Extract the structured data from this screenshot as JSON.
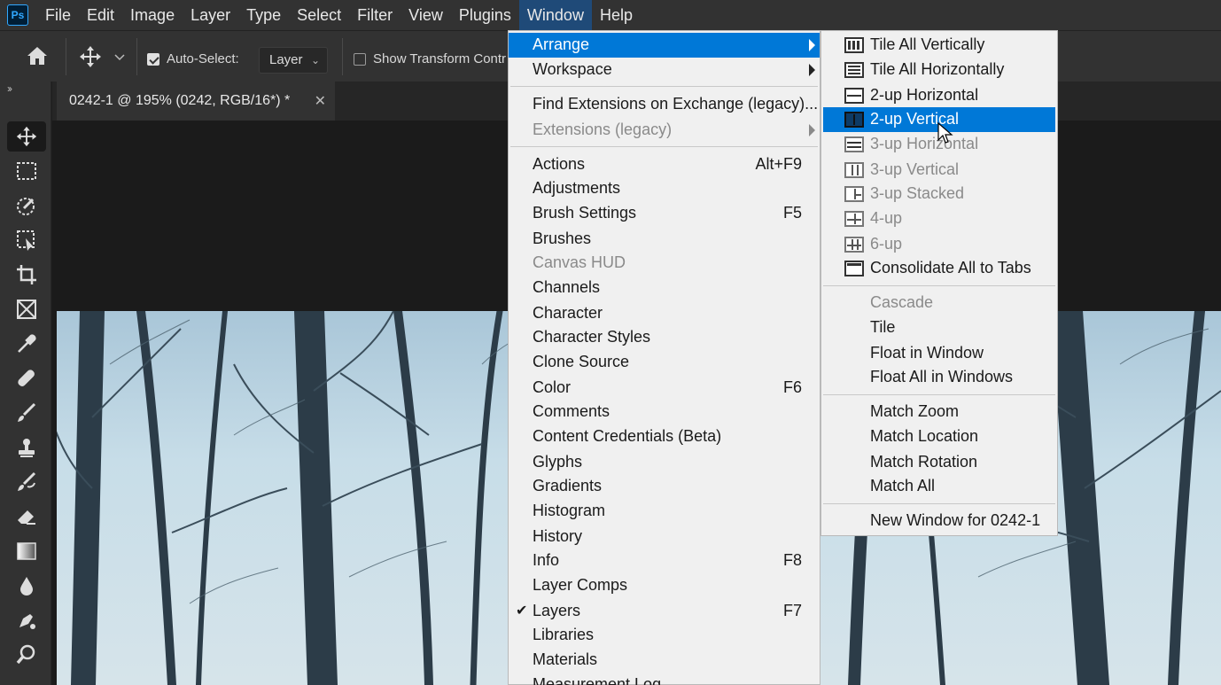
{
  "app": {
    "logo_text": "Ps"
  },
  "menubar": {
    "items": [
      "File",
      "Edit",
      "Image",
      "Layer",
      "Type",
      "Select",
      "Filter",
      "View",
      "Plugins",
      "Window",
      "Help"
    ],
    "active": "Window"
  },
  "options": {
    "auto_select_label": "Auto-Select:",
    "auto_select_checked": true,
    "auto_select_target": "Layer",
    "show_transform_label": "Show Transform Contr"
  },
  "tools": [
    "move-tool",
    "marquee-tool",
    "object-selection-tool",
    "frame-select-tool",
    "crop-tool",
    "frame-tool",
    "eyedropper-tool",
    "healing-brush-tool",
    "brush-tool",
    "clone-stamp-tool",
    "history-brush-tool",
    "eraser-tool",
    "gradient-tool",
    "blur-tool",
    "pen-tool",
    "zoom-tool"
  ],
  "document": {
    "tab_title": "0242-1 @ 195% (0242, RGB/16*) *"
  },
  "window_menu": {
    "items": [
      {
        "label": "Arrange",
        "submenu": true,
        "highlighted": true
      },
      {
        "label": "Workspace",
        "submenu": true
      },
      {
        "label": "Find Extensions on Exchange (legacy)..."
      },
      {
        "label": "Extensions (legacy)",
        "submenu": true,
        "disabled": true
      },
      {
        "label": "Actions",
        "shortcut": "Alt+F9"
      },
      {
        "label": "Adjustments"
      },
      {
        "label": "Brush Settings",
        "shortcut": "F5"
      },
      {
        "label": "Brushes"
      },
      {
        "label": "Canvas HUD",
        "disabled": true
      },
      {
        "label": "Channels"
      },
      {
        "label": "Character"
      },
      {
        "label": "Character Styles"
      },
      {
        "label": "Clone Source"
      },
      {
        "label": "Color",
        "shortcut": "F6"
      },
      {
        "label": "Comments"
      },
      {
        "label": "Content Credentials (Beta)"
      },
      {
        "label": "Glyphs"
      },
      {
        "label": "Gradients"
      },
      {
        "label": "Histogram"
      },
      {
        "label": "History"
      },
      {
        "label": "Info",
        "shortcut": "F8"
      },
      {
        "label": "Layer Comps"
      },
      {
        "label": "Layers",
        "shortcut": "F7",
        "checked": true
      },
      {
        "label": "Libraries"
      },
      {
        "label": "Materials"
      },
      {
        "label": "Measurement Log"
      }
    ]
  },
  "arrange_menu": {
    "items": [
      {
        "label": "Tile All Vertically",
        "icon": "tile-vertical-icon"
      },
      {
        "label": "Tile All Horizontally",
        "icon": "tile-horizontal-icon"
      },
      {
        "label": "2-up Horizontal",
        "icon": "two-up-horizontal-icon"
      },
      {
        "label": "2-up Vertical",
        "icon": "two-up-vertical-icon",
        "highlighted": true
      },
      {
        "label": "3-up Horizontal",
        "icon": "three-up-horizontal-icon",
        "disabled": true
      },
      {
        "label": "3-up Vertical",
        "icon": "three-up-vertical-icon",
        "disabled": true
      },
      {
        "label": "3-up Stacked",
        "icon": "three-up-stacked-icon",
        "disabled": true
      },
      {
        "label": "4-up",
        "icon": "four-up-icon",
        "disabled": true
      },
      {
        "label": "6-up",
        "icon": "six-up-icon",
        "disabled": true
      },
      {
        "label": "Consolidate All to Tabs",
        "icon": "consolidate-tabs-icon"
      },
      {
        "label": "Cascade",
        "disabled": true
      },
      {
        "label": "Tile"
      },
      {
        "label": "Float in Window"
      },
      {
        "label": "Float All in Windows"
      },
      {
        "label": "Match Zoom"
      },
      {
        "label": "Match Location"
      },
      {
        "label": "Match Rotation"
      },
      {
        "label": "Match All"
      },
      {
        "label": "New Window for 0242-1"
      }
    ]
  },
  "colors": {
    "menu_highlight": "#0078d7",
    "chrome": "#323232",
    "menu_bg": "#f0f0f0"
  }
}
